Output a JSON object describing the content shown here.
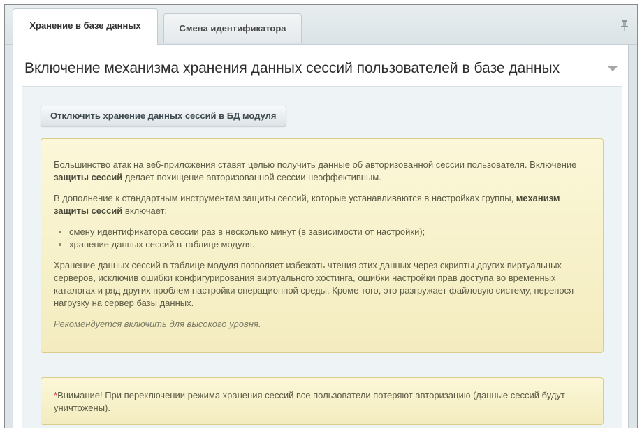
{
  "tabs": [
    {
      "label": "Хранение в базе данных",
      "active": true
    },
    {
      "label": "Смена идентификатора",
      "active": false
    }
  ],
  "panel": {
    "title": "Включение механизма хранения данных сессий пользователей в базе данных"
  },
  "action_button": {
    "label": "Отключить хранение данных сессий в БД модуля"
  },
  "info": {
    "p1_start": "Большинство атак на веб-приложения ставят целью получить данные об авторизованной сессии пользователя. Включение ",
    "p1_bold": "защиты сессий",
    "p1_end": " делает похищение авторизованной сессии неэффективным.",
    "p2_start": "В дополнение к стандартным инструментам защиты сессий, которые устанавливаются в настройках группы, ",
    "p2_bold": "механизм защиты сессий",
    "p2_end": " включает:",
    "list": [
      "смену идентификатора сессии раз в несколько минут (в зависимости от настройки);",
      "хранение данных сессий в таблице модуля."
    ],
    "p3": "Хранение данных сессий в таблице модуля позволяет избежать чтения этих данных через скрипты других виртуальных серверов, исключив ошибки конфигурирования виртуального хостинга, ошибки настройки прав доступа во временных каталогах и ряд других проблем настройки операционной среды. Кроме того, это разгружает файловую систему, перенося нагрузку на сервер базы данных.",
    "recommend": "Рекомендуется включить для высокого уровня."
  },
  "warning": {
    "marker": "*",
    "text": "Внимание! При переключении режима хранения сессий все пользователи потеряют авторизацию (данные сессий будут уничтожены)."
  },
  "colors": {
    "note_bg": "#fbf7d8",
    "note_border": "#d9cd8c",
    "required_marker": "#d23a3a"
  }
}
